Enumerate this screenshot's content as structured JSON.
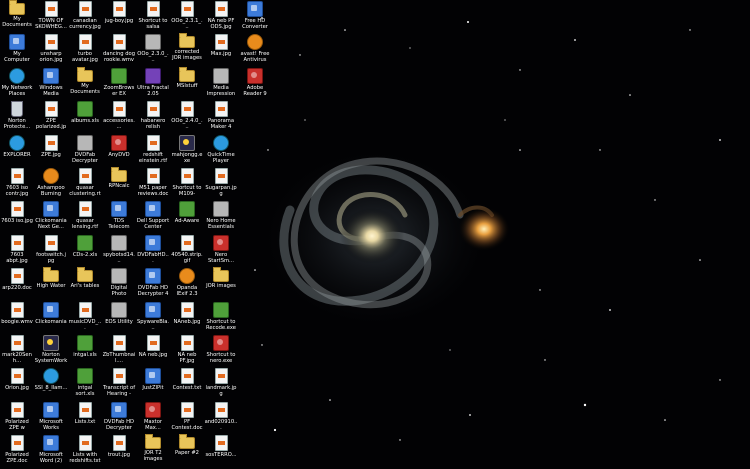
{
  "desktop": {
    "icons": [
      {
        "label": "My Documents",
        "icon": "folder"
      },
      {
        "label": "TOWN OF SKOWHEG...",
        "icon": "file"
      },
      {
        "label": "canadian currency.jpg",
        "icon": "file"
      },
      {
        "label": "jug-boy.jpg",
        "icon": "file"
      },
      {
        "label": "Shortcut to salsa genti...",
        "icon": "file"
      },
      {
        "label": "OOo_2.3.1_...",
        "icon": "file"
      },
      {
        "label": "NA neb PF ODS.jpg",
        "icon": "file"
      },
      {
        "label": "My Computer",
        "icon": "app"
      },
      {
        "label": "unsharp orion.jpg",
        "icon": "file"
      },
      {
        "label": "turbo avatar.jpg",
        "icon": "file"
      },
      {
        "label": "dancing dog rookie.wmv",
        "icon": "file"
      },
      {
        "label": "OOo_2.3.0_...",
        "icon": "gray"
      },
      {
        "label": "corrected JOR images",
        "icon": "folder"
      },
      {
        "label": "Max.jpg",
        "icon": "file"
      },
      {
        "label": "My Network Places",
        "icon": "net"
      },
      {
        "label": "Windows Media Player",
        "icon": "app"
      },
      {
        "label": "My Documents",
        "icon": "folder"
      },
      {
        "label": "ZoomBrowser EX",
        "icon": "green"
      },
      {
        "label": "Ultra Fractal 2.05",
        "icon": "purple"
      },
      {
        "label": "MSIstuff",
        "icon": "folder"
      },
      {
        "label": "Media Impression",
        "icon": "gray"
      },
      {
        "label": "Norton Protecte...",
        "icon": "trash"
      },
      {
        "label": "ZPE polarized.jpg",
        "icon": "file"
      },
      {
        "label": "albums.xls",
        "icon": "green"
      },
      {
        "label": "accessories....",
        "icon": "file"
      },
      {
        "label": "habanero relish 003.jpg",
        "icon": "file"
      },
      {
        "label": "OOo_2.4.0_...",
        "icon": "file"
      },
      {
        "label": "Panorama Maker 4",
        "icon": "file"
      },
      {
        "label": "EXPLORER",
        "icon": "net"
      },
      {
        "label": "ZPE.jpg",
        "icon": "file"
      },
      {
        "label": "DVDFab Decrypter",
        "icon": "gray"
      },
      {
        "label": "AnyDVD",
        "icon": "red"
      },
      {
        "label": "redshift einstein.rtf",
        "icon": "file"
      },
      {
        "label": "mahjongg.exe",
        "icon": "spark"
      },
      {
        "label": "QuickTime Player",
        "icon": "net"
      },
      {
        "label": "7603 iso contr.jpg",
        "icon": "file"
      },
      {
        "label": "Ashampoo Burning Stu...",
        "icon": "orange"
      },
      {
        "label": "quasar clustering.rtf",
        "icon": "file"
      },
      {
        "label": "RPNcalc",
        "icon": "folder"
      },
      {
        "label": "M51 paper reviews.doc",
        "icon": "file"
      },
      {
        "label": "Shortcut to M109-0805...",
        "icon": "file"
      },
      {
        "label": "Sugarpan.jpg",
        "icon": "file"
      },
      {
        "label": "7603 iso.jpg",
        "icon": "file"
      },
      {
        "label": "Clickomania Next Ge...",
        "icon": "app"
      },
      {
        "label": "quasar lensing.rtf",
        "icon": "file"
      },
      {
        "label": "TDS Telecom",
        "icon": "app"
      },
      {
        "label": "Dell Support Center",
        "icon": "app"
      },
      {
        "label": "Ad-Aware",
        "icon": "green"
      },
      {
        "label": "Nero Home Essentials SE",
        "icon": "gray"
      },
      {
        "label": "7603 abpt.jpg",
        "icon": "file"
      },
      {
        "label": "footswitch.jpg",
        "icon": "file"
      },
      {
        "label": "CDs-2.xls",
        "icon": "green"
      },
      {
        "label": "spybotsd14...",
        "icon": "gray"
      },
      {
        "label": "DVDFabHD...",
        "icon": "app"
      },
      {
        "label": "40540.strip.gif",
        "icon": "file"
      },
      {
        "label": "Nero StartSm...",
        "icon": "red"
      },
      {
        "label": "arp220.doc",
        "icon": "file"
      },
      {
        "label": "High Water",
        "icon": "folder"
      },
      {
        "label": "Ari's tables",
        "icon": "folder"
      },
      {
        "label": "Digital Photo Professional",
        "icon": "gray"
      },
      {
        "label": "DVDFab HD Decrypter 4",
        "icon": "app"
      },
      {
        "label": "Opanda IExif 2.3",
        "icon": "orange"
      },
      {
        "label": "JOR images",
        "icon": "folder"
      },
      {
        "label": "boogie.wmv",
        "icon": "file"
      },
      {
        "label": "Clickomania",
        "icon": "app"
      },
      {
        "label": "musicDVD_...",
        "icon": "file"
      },
      {
        "label": "EOS Utility",
        "icon": "gray"
      },
      {
        "label": "SpywareBla...",
        "icon": "app"
      },
      {
        "label": "NAneb.jpg",
        "icon": "file"
      },
      {
        "label": "Shortcut to Recode.exe",
        "icon": "green"
      },
      {
        "label": "mark20Senh...",
        "icon": "file"
      },
      {
        "label": "Norton SystemWorks",
        "icon": "spark"
      },
      {
        "label": "intgal.xls",
        "icon": "green"
      },
      {
        "label": "ZbThumbnail....",
        "icon": "file"
      },
      {
        "label": "NA neb.jpg",
        "icon": "file"
      },
      {
        "label": "NA neb PF.jpg",
        "icon": "file"
      },
      {
        "label": "Shortcut to nero.exe",
        "icon": "red"
      },
      {
        "label": "Orion.jpg",
        "icon": "file"
      },
      {
        "label": "SSI_8_Ilam...",
        "icon": "net"
      },
      {
        "label": "intgal sort.xls",
        "icon": "green"
      },
      {
        "label": "Transcript of Hearing -an...",
        "icon": "file"
      },
      {
        "label": "JustZIPit",
        "icon": "app"
      },
      {
        "label": "Contest.txt",
        "icon": "file"
      },
      {
        "label": "landmark.jpg",
        "icon": "file"
      },
      {
        "label": "Polarized ZPE w citations.doc",
        "icon": "file"
      },
      {
        "label": "Microsoft Works",
        "icon": "app"
      },
      {
        "label": "Lists.txt",
        "icon": "file"
      },
      {
        "label": "DVDFab HD Decrypter",
        "icon": "app"
      },
      {
        "label": "Maxtor Max...",
        "icon": "red"
      },
      {
        "label": "PF Contest.doc",
        "icon": "file"
      },
      {
        "label": "and020910...",
        "icon": "file"
      },
      {
        "label": "Polarized ZPE.doc",
        "icon": "file"
      },
      {
        "label": "Microsoft Word (2)",
        "icon": "app"
      },
      {
        "label": "Lists with redshifts.txt",
        "icon": "file"
      },
      {
        "label": "trout.jpg",
        "icon": "file"
      },
      {
        "label": "JOR T2 images",
        "icon": "folder"
      },
      {
        "label": "Paper #2",
        "icon": "folder"
      },
      {
        "label": "sosTERRO...",
        "icon": "file"
      }
    ],
    "right_icons": [
      {
        "label": "Free HD Converter",
        "icon": "app"
      },
      {
        "label": "avast! Free Antivirus",
        "icon": "orange"
      },
      {
        "label": "Adobe Reader 9",
        "icon": "red"
      }
    ]
  }
}
